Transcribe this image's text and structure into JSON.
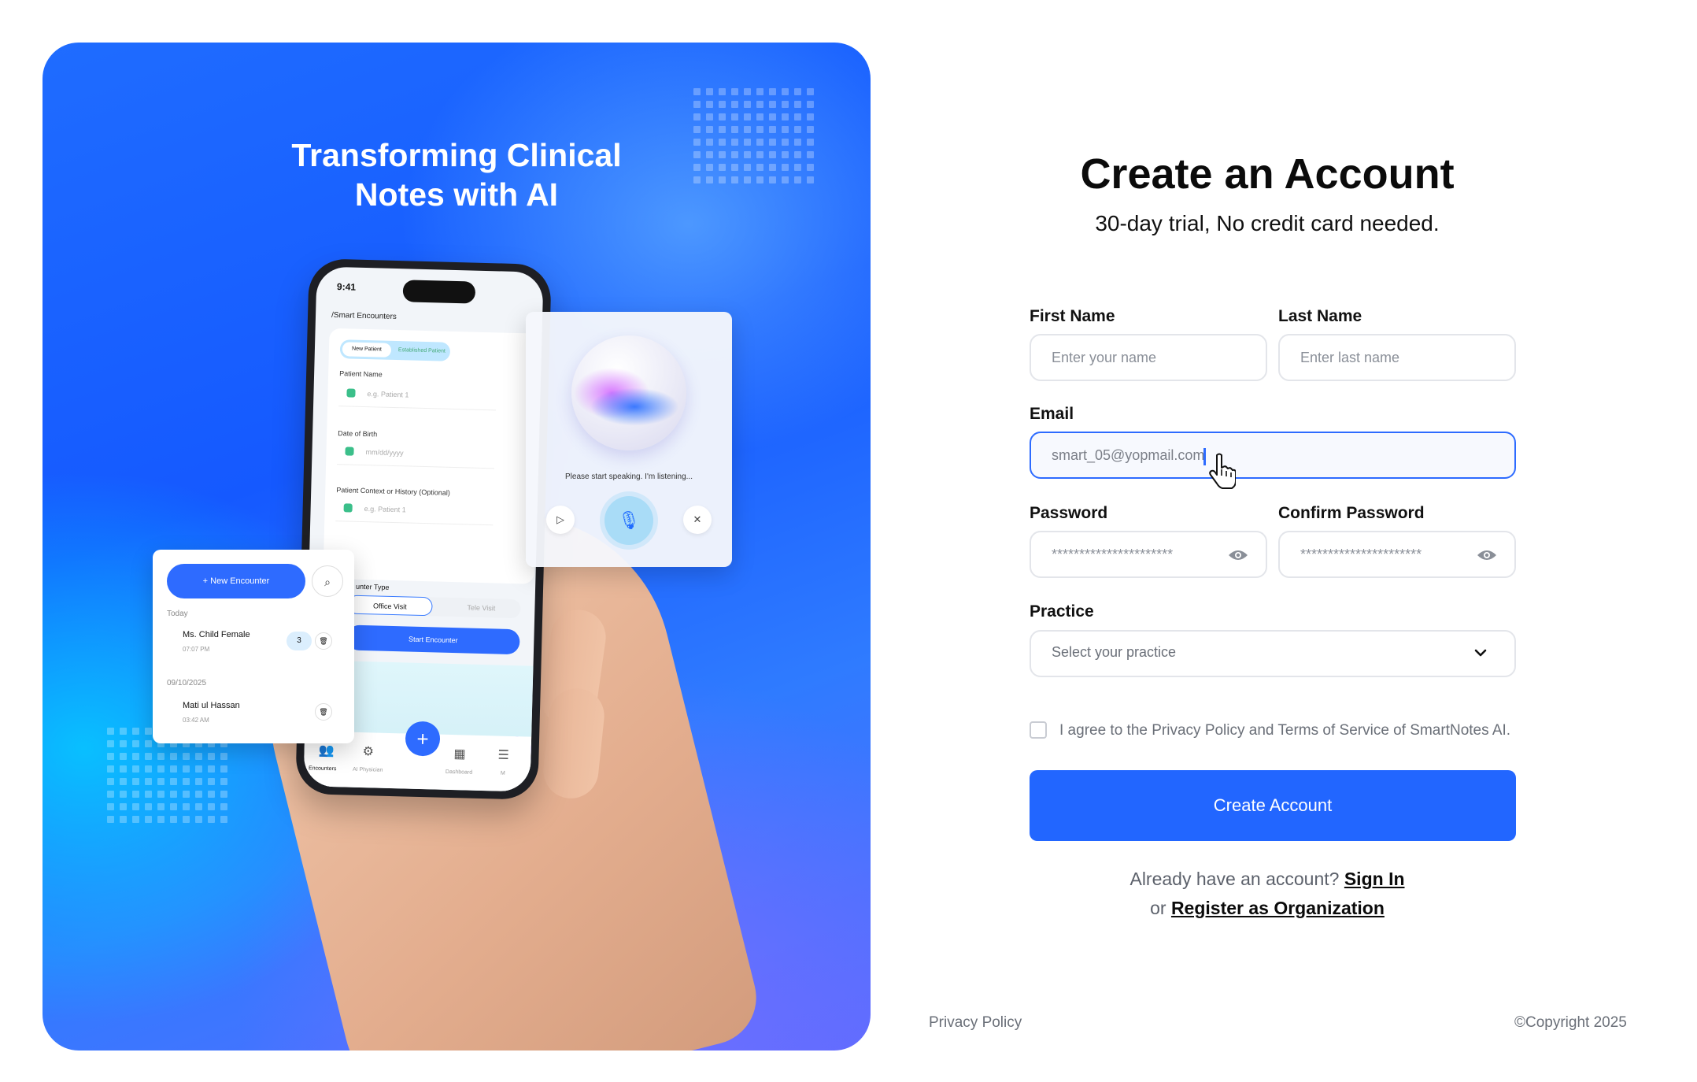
{
  "hero": {
    "title_line1": "Transforming Clinical",
    "title_line2": "Notes with AI",
    "phone": {
      "time": "9:41",
      "breadcrumb": "/Smart Encounters",
      "tab_new": "New Patient",
      "tab_established": "Established Patient",
      "patient_name_label": "Patient Name",
      "patient_name_placeholder": "e.g. Patient 1",
      "dob_label": "Date of Birth",
      "dob_placeholder": "mm/dd/yyyy",
      "context_label": "Patient Context or History (Optional)",
      "context_placeholder": "e.g. Patient 1",
      "encounter_type_label": "unter Type",
      "office_visit": "Office Visit",
      "tele_visit": "Tele Visit",
      "start_encounter": "Start Encounter",
      "nav": [
        "Encounters",
        "AI Physician",
        "Dashboard",
        "M"
      ]
    },
    "voice_card": {
      "prompt": "Please start speaking. I'm listening..."
    },
    "encounters_card": {
      "new_encounter": "+ New Encounter",
      "group_today": "Today",
      "item1_name": "Ms. Child Female",
      "item1_time": "07:07 PM",
      "item1_badge": "3",
      "group_date": "09/10/2025",
      "item2_name": "Mati ul Hassan",
      "item2_time": "03:42 AM"
    }
  },
  "form": {
    "title": "Create an Account",
    "subtitle": "30-day trial, No credit card needed.",
    "first_name_label": "First Name",
    "first_name_placeholder": "Enter your name",
    "last_name_label": "Last Name",
    "last_name_placeholder": "Enter last name",
    "email_label": "Email",
    "email_value": "smart_05@yopmail.com",
    "password_label": "Password",
    "password_value": "**********************",
    "confirm_password_label": "Confirm Password",
    "confirm_password_value": "**********************",
    "practice_label": "Practice",
    "practice_placeholder": "Select your practice",
    "agree_text": "I agree to the Privacy Policy and Terms of Service of SmartNotes AI.",
    "submit_label": "Create Account",
    "have_account_text": "Already have an account?",
    "sign_in_link": "Sign In",
    "or_text": "or",
    "register_org_link": "Register as Organization"
  },
  "footer": {
    "privacy_link": "Privacy Policy",
    "copyright": "©Copyright 2025"
  },
  "colors": {
    "accent": "#2266ff",
    "focus_border": "#2d6bff"
  }
}
